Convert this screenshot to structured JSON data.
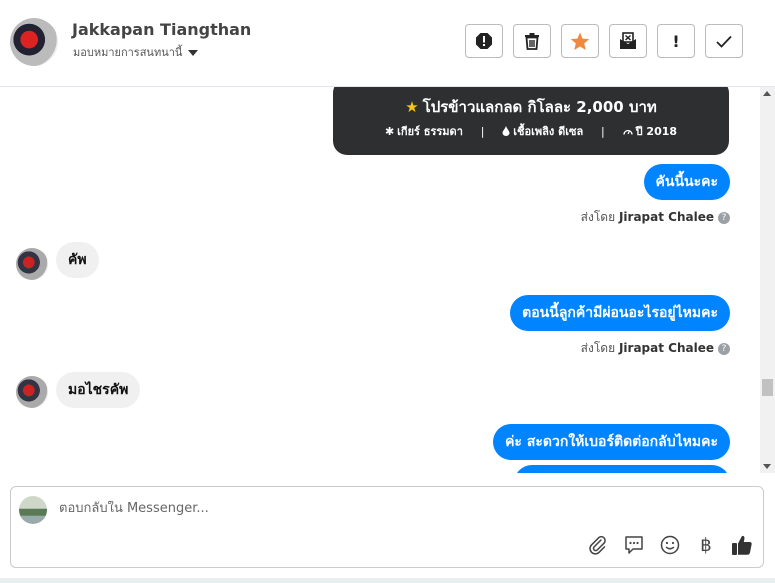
{
  "header": {
    "contact_name": "Jakkapan Tiangthan",
    "assign_label": "มอบหมายการสนทนานี้",
    "buttons": [
      {
        "icon": "alert-octagon-icon"
      },
      {
        "icon": "trash-icon"
      },
      {
        "icon": "star-icon",
        "color": "#f0883e"
      },
      {
        "icon": "mail-x-icon"
      },
      {
        "icon": "exclamation-icon",
        "label": "!"
      },
      {
        "icon": "check-icon"
      }
    ]
  },
  "chat": {
    "card": {
      "promo_star": "★",
      "promo": "โปรข้าวแลกลด กิโลละ 2,000 บาท",
      "gear": "เกียร์ ธรรมดา",
      "fuel": "เชื้อเพลิง ดีเซล",
      "year": "ปี 2018",
      "sep": "|"
    },
    "messages": [
      {
        "text": "คันนี้นะคะ"
      },
      {
        "text": "คัพ"
      },
      {
        "text": "ตอนนี้ลูกค้ามีผ่อนอะไรอยู่ไหมคะ"
      },
      {
        "text": "มอไชรคัพ"
      },
      {
        "text": "ค่ะ สะดวกให้เบอร์ติดต่อกลับไหมคะ"
      }
    ],
    "sent_by_prefix": "ส่งโดย",
    "sent_by_name": "Jirapat Chalee",
    "help_mark": "?"
  },
  "composer": {
    "placeholder": "ตอบกลับใน Messenger...",
    "currency_symbol": "฿"
  },
  "colors": {
    "accent_blue": "#0084ff",
    "card_bg": "#2d2f31",
    "star_yellow": "#f5c518",
    "star_button": "#f0883e"
  }
}
